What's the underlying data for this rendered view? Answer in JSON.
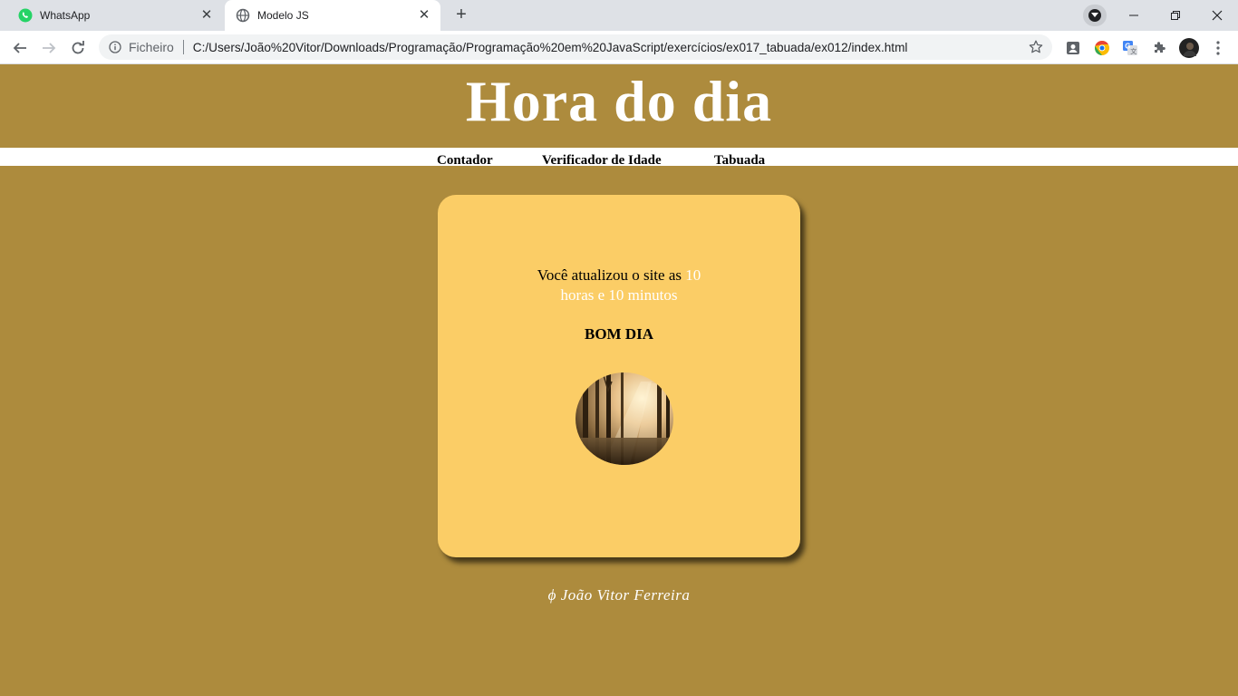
{
  "browser": {
    "tabs": [
      {
        "title": "WhatsApp",
        "icon": "whatsapp-icon"
      },
      {
        "title": "Modelo JS",
        "icon": "globe-icon"
      }
    ],
    "close_glyph": "✕",
    "new_tab_glyph": "+",
    "scheme_label": "Ficheiro",
    "url": "C:/Users/João%20Vitor/Downloads/Programação/Programação%20em%20JavaScript/exercícios/ex017_tabuada/ex012/index.html",
    "accent_color": "#1a73e8"
  },
  "page": {
    "background_color": "#ad8b3d",
    "card_color": "#fbcd66",
    "title": "Hora do dia",
    "menu": [
      "Contador",
      "Verificador de Idade",
      "Tabuada"
    ],
    "message_prefix": "Você atualizou o site as ",
    "message_time": "10 horas e 10 minutos",
    "greeting": "BOM DIA",
    "image_alt": "forest-morning-photo",
    "footer": "ϕ João Vitor Ferreira"
  }
}
